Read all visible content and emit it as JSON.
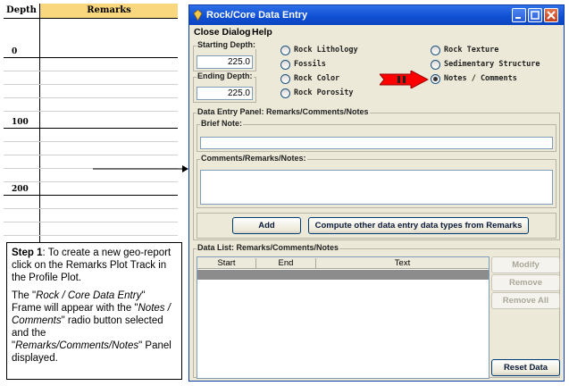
{
  "plot": {
    "depth_header": "Depth",
    "remarks_header": "Remarks",
    "depth_labels": [
      "0",
      "100",
      "200"
    ]
  },
  "callout": {
    "step_label": "Step 1",
    "step_text": ": To create a new geo-report click on the Remarks Plot Track in the Profile Plot.",
    "p2_a": "The \"",
    "p2_frame": "Rock / Core Data Entry",
    "p2_b": "\" Frame will appear with the \"",
    "p2_radio": "Notes / Comments",
    "p2_c": "\" radio button selected and the \"",
    "p2_panel": "Remarks/Comments/Notes",
    "p2_d": "\" Panel displayed."
  },
  "window": {
    "title": "Rock/Core Data Entry",
    "menu": {
      "close": "Close Dialog",
      "help": "Help"
    },
    "starting_depth": {
      "label": "Starting Depth:",
      "value": "225.0"
    },
    "ending_depth": {
      "label": "Ending Depth:",
      "value": "225.0"
    },
    "radios": {
      "lithology": "Rock Lithology",
      "texture": "Rock Texture",
      "fossils": "Fossils",
      "sedimentary": "Sedimentary Structure",
      "color": "Rock Color",
      "notes": "Notes / Comments",
      "porosity": "Rock Porosity"
    },
    "selected_radio": "Notes / Comments",
    "entry_panel": {
      "title": "Data Entry Panel: Remarks/Comments/Notes",
      "brief_note_label": "Brief Note:",
      "comments_label": "Comments/Remarks/Notes:",
      "add_button": "Add",
      "compute_button": "Compute other data entry data types from Remarks"
    },
    "data_list": {
      "title": "Data List: Remarks/Comments/Notes",
      "columns": [
        "Start",
        "End",
        "Text"
      ],
      "modify_button": "Modify",
      "remove_button": "Remove",
      "remove_all_button": "Remove All",
      "reset_button": "Reset Data"
    }
  },
  "colors": {
    "remarks_header": "#f8d77f",
    "title_bar": "#0e4fd2",
    "window_bg": "#ece9d8",
    "callout_arrow": "#ff0000"
  }
}
